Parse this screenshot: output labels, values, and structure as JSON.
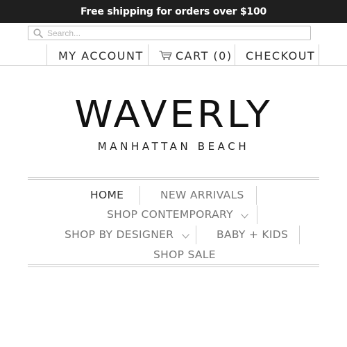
{
  "promo": {
    "text": "Free shipping for orders over $100"
  },
  "search": {
    "placeholder": "Search...",
    "value": ""
  },
  "account_nav": {
    "my_account": "MY ACCOUNT",
    "cart": "CART (0)",
    "checkout": "CHECKOUT"
  },
  "logo": {
    "main": "WAVERLY",
    "sub": "MANHATTAN BEACH"
  },
  "main_nav": {
    "items": [
      {
        "label": "HOME",
        "active": true
      },
      {
        "label": "NEW ARRIVALS"
      },
      {
        "label": "SHOP CONTEMPORARY",
        "has_dropdown": true
      },
      {
        "label": "SHOP BY DESIGNER",
        "has_dropdown": true
      },
      {
        "label": "BABY + KIDS"
      },
      {
        "label": "SHOP SALE"
      }
    ]
  },
  "colors": {
    "promo_bg": "#1f1f1f",
    "promo_text": "#ffffff",
    "nav_text": "#777777",
    "active_text": "#333333",
    "rule": "#c9c9c9"
  },
  "icons": [
    "search-icon",
    "cart-icon",
    "chevron-down-icon"
  ]
}
